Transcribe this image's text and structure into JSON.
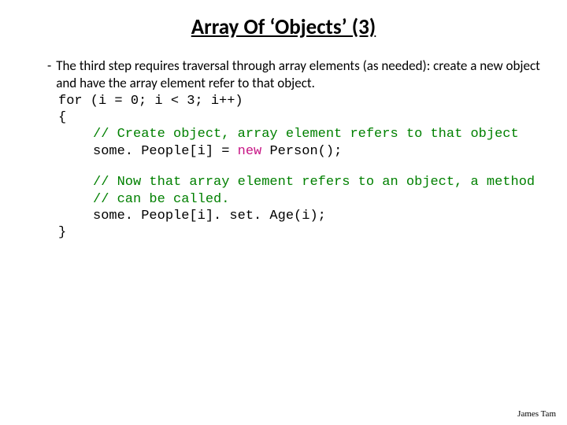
{
  "title": "Array Of ‘Objects’ (3)",
  "bullet": {
    "dash": "-",
    "text": "The third step requires traversal through array elements (as needed): create a new object and have the array element refer to that object."
  },
  "code": {
    "forLine": "for (i = 0; i < 3; i++)",
    "openBrace": "{",
    "comment1": "// Create object, array element refers to that object",
    "stmt1a": "some. People[i] = ",
    "newKw": "new",
    "stmt1b": " Person();",
    "comment2a": "// Now that array element refers to an object, a method",
    "comment2b": "// can be called.",
    "stmt2": "some. People[i]. set. Age(i);",
    "closeBrace": "}"
  },
  "footer": "James Tam"
}
